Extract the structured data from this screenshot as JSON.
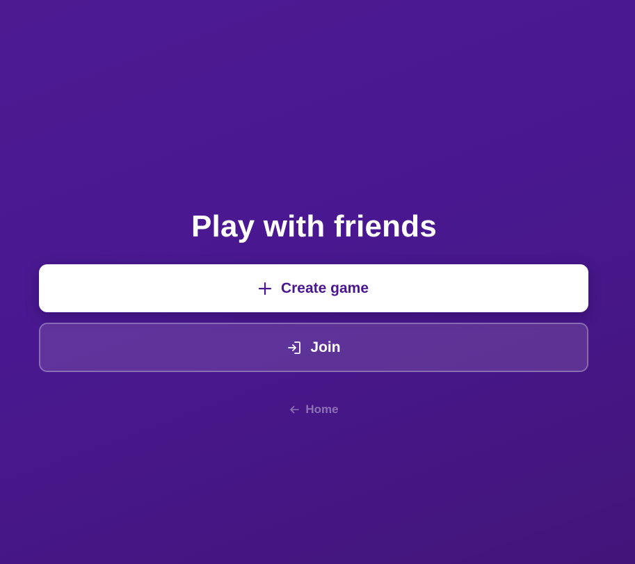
{
  "page": {
    "title": "Play with friends"
  },
  "actions": {
    "create_label": "Create game",
    "create_icon": "plus-icon",
    "join_label": "Join",
    "join_icon": "login-icon"
  },
  "nav": {
    "home_label": "Home",
    "home_icon": "arrow-left-icon"
  },
  "colors": {
    "background": "#4a1790",
    "accent": "#4a1590",
    "button_primary_bg": "#ffffff",
    "text_light": "#ffffff"
  }
}
